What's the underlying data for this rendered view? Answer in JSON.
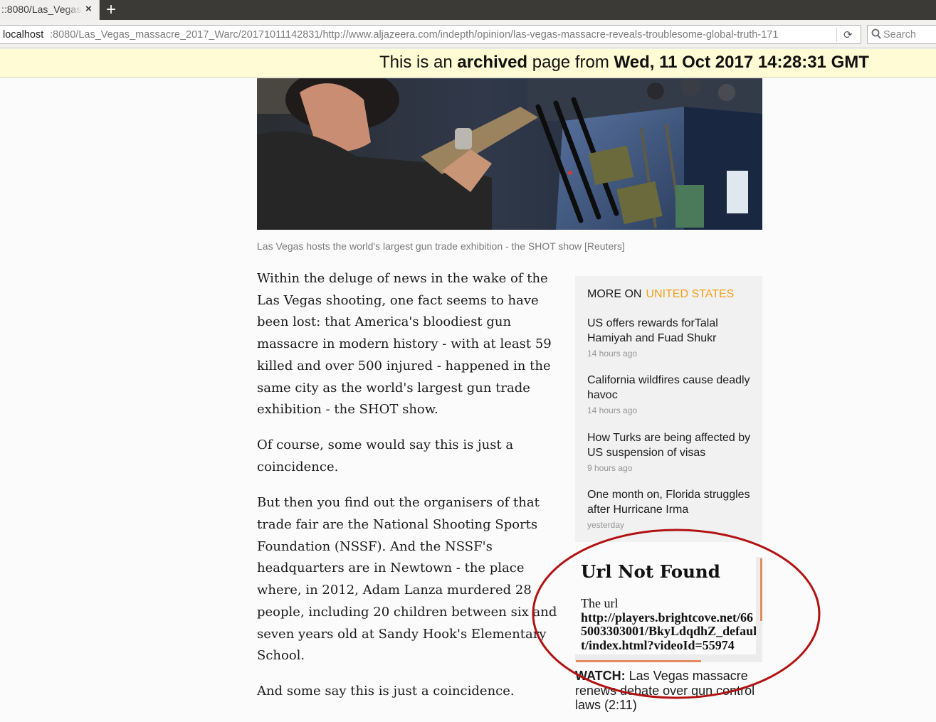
{
  "browser": {
    "tab_title": "::8080/Las_Vegas",
    "tab_close": "×",
    "new_tab": "+",
    "url_host": "localhost",
    "url_rest": ":8080/Las_Vegas_massacre_2017_Warc/20171011142831/http://www.aljazeera.com/indepth/opinion/las-vegas-massacre-reveals-troublesome-global-truth-171",
    "reload_icon": "⟳",
    "search_placeholder": "Search"
  },
  "archive_banner": {
    "prefix": "This is an ",
    "archived": "archived",
    "middle": " page from ",
    "date": "Wed, 11 Oct 2017 14:28:31 GMT"
  },
  "hero": {
    "caption": "Las Vegas hosts the world's largest gun trade exhibition - the SHOT show [Reuters]"
  },
  "article": {
    "paragraphs": [
      "Within the deluge of news in the wake of the Las Vegas shooting, one fact seems to have been lost: that America's bloodiest gun massacre in modern history - with at least 59 killed and over 500 injured - happened in the same city as the world's largest gun trade exhibition - the SHOT show.",
      "Of course, some would say this is just a coincidence.",
      "But then you find out the organisers of that trade fair are the National Shooting Sports Foundation (NSSF). And the NSSF's headquarters are in Newtown - the place where, in 2012, Adam Lanza murdered 28 people, including 20 children between six and seven years old at Sandy Hook's Elementary School.",
      "And some say this is just a coincidence."
    ]
  },
  "sidebar": {
    "heading_prefix": "MORE ON",
    "heading_topic": "UNITED STATES",
    "stories": [
      {
        "title": "US offers rewards forTalal Hamiyah and Fuad Shukr",
        "time": "14 hours ago"
      },
      {
        "title": "California wildfires cause deadly havoc",
        "time": "14 hours ago"
      },
      {
        "title": "How Turks are being affected by US suspension of visas",
        "time": "9 hours ago"
      },
      {
        "title": "One month on, Florida struggles after Hurricane Irma",
        "time": "yesterday"
      }
    ]
  },
  "embed": {
    "title": "Url Not Found",
    "body_prefix": "The url",
    "url": "http://players.brightcove.net/665003303001/BkyLdqdhZ_default/index.html?videoId=55974"
  },
  "watch": {
    "label": "WATCH:",
    "text": " Las Vegas massacre renews debate over gun control laws (2:11)"
  },
  "colors": {
    "accent_topic": "#f0a01a",
    "annotation": "#b11212",
    "banner_bg": "#fffbd4"
  }
}
